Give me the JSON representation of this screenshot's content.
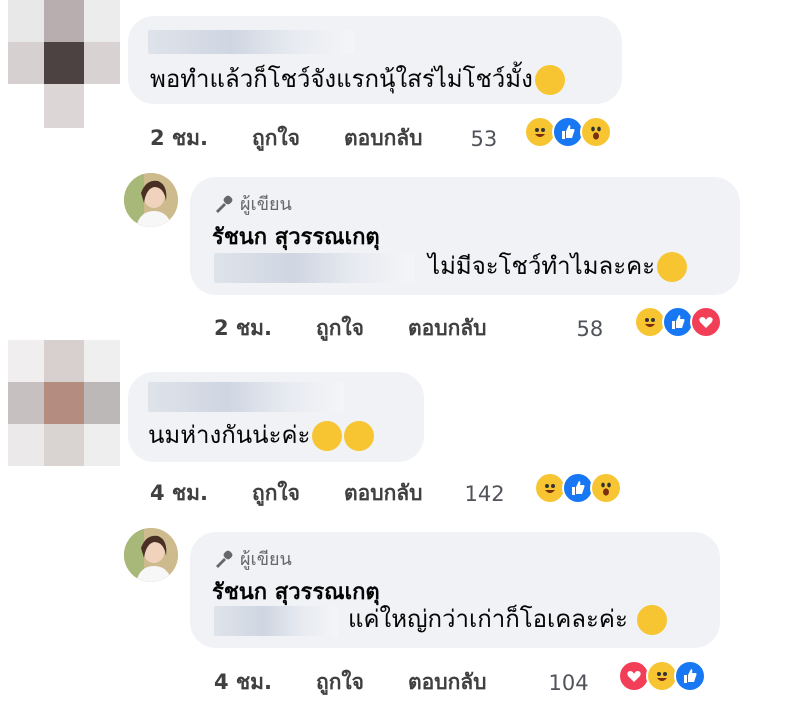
{
  "comments": [
    {
      "text": "พอทำแล้วก็โชว์จังแรกนุ้ใสร่ไม่โชว์มั้ง",
      "time": "2 ชม.",
      "like_label": "ถูกใจ",
      "reply_label": "ตอบกลับ",
      "reaction_count": "53",
      "reactions": [
        "haha",
        "like",
        "wow"
      ]
    },
    {
      "author_badge": "ผู้เขียน",
      "author_name": "รัชนก สุวรรณเกตุ",
      "text": "ไม่มีจะโชว์ทำไมละคะ",
      "time": "2 ชม.",
      "like_label": "ถูกใจ",
      "reply_label": "ตอบกลับ",
      "reaction_count": "58",
      "reactions": [
        "haha",
        "like",
        "love"
      ]
    },
    {
      "text": "นมห่างกันน่ะค่ะ",
      "time": "4 ชม.",
      "like_label": "ถูกใจ",
      "reply_label": "ตอบกลับ",
      "reaction_count": "142",
      "reactions": [
        "haha",
        "like",
        "wow"
      ]
    },
    {
      "author_badge": "ผู้เขียน",
      "author_name": "รัชนก สุวรรณเกตุ",
      "text": "แค่ใหญ่กว่าเก่าก็โอเคละค่ะ",
      "time": "4 ชม.",
      "like_label": "ถูกใจ",
      "reply_label": "ตอบกลับ",
      "reaction_count": "104",
      "reactions": [
        "love",
        "haha",
        "like"
      ]
    }
  ],
  "colors": {
    "bubble": "#f0f2f5",
    "like": "#1877f2",
    "love": "#f33e58",
    "haha": "#f7c531",
    "meta_text": "#404040"
  }
}
